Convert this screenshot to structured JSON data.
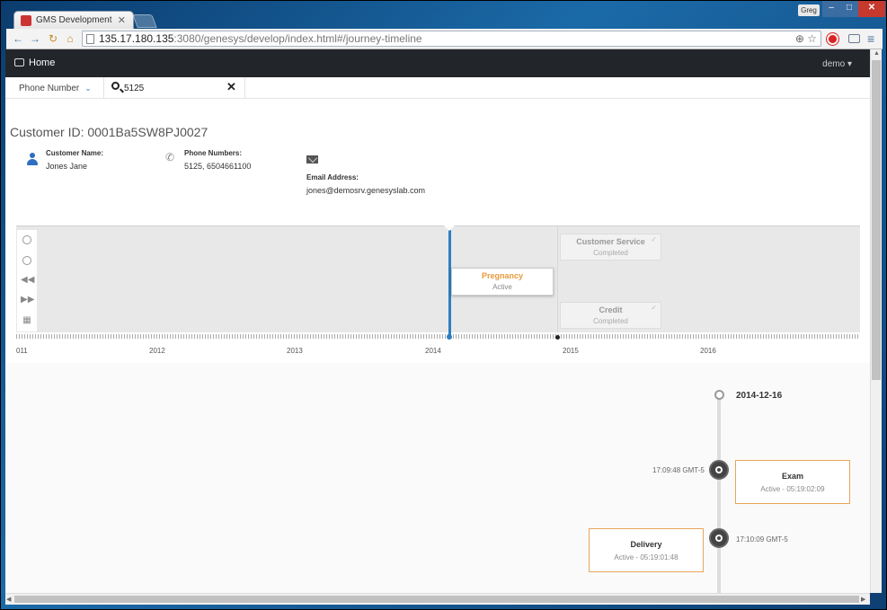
{
  "browser": {
    "tab_title": "GMS Development",
    "user": "Greg",
    "url_host": "135.17.180.135",
    "url_path": ":3080/genesys/develop/index.html#/journey-timeline"
  },
  "nav": {
    "home": "Home",
    "user_menu": "demo"
  },
  "search": {
    "type": "Phone Number",
    "value": "5125"
  },
  "customer": {
    "title": "Customer ID: 0001Ba5SW8PJ0027",
    "name_label": "Customer Name:",
    "name": "Jones Jane",
    "phone_label": "Phone Numbers:",
    "phones": "5125, 6504661100",
    "email_label": "Email Address:",
    "email": "jones@demosrv.genesyslab.com"
  },
  "timeline": {
    "years": [
      "011",
      "2012",
      "2013",
      "2014",
      "2015",
      "2016"
    ],
    "events": [
      {
        "title": "Pregnancy",
        "status": "Active"
      },
      {
        "title": "Customer Service",
        "status": "Completed"
      },
      {
        "title": "Credit",
        "status": "Completed"
      }
    ]
  },
  "journey": {
    "date": "2014-12-16",
    "items": [
      {
        "time": "17:09:48 GMT-5",
        "title": "Exam",
        "status": "Active - 05:19:02:09"
      },
      {
        "time": "17:10:09 GMT-5",
        "title": "Delivery",
        "status": "Active - 05:19:01:48"
      }
    ]
  },
  "colors": {
    "accent": "#2d7fc1",
    "active": "#e89a3c",
    "navbar": "#22252a"
  }
}
